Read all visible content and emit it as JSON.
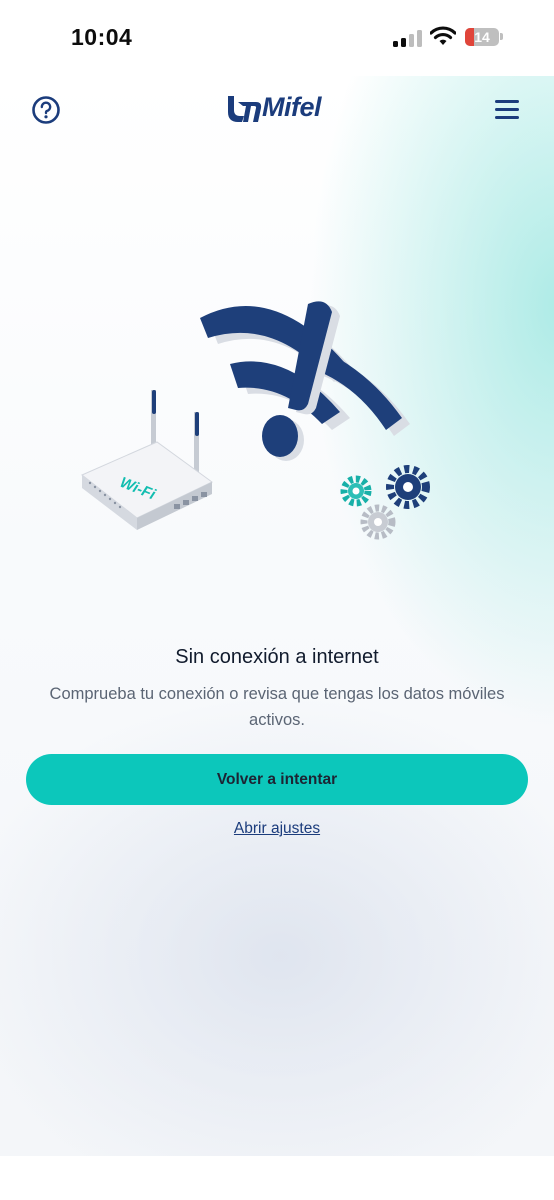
{
  "status_bar": {
    "time": "10:04",
    "battery_level": "14",
    "battery_color": "#e0453a",
    "signal_icon": "cellular-signal-icon",
    "wifi_icon": "wifi-icon"
  },
  "header": {
    "help_icon": "question-circle-icon",
    "logo_text": "Mifel",
    "menu_icon": "hamburger-menu-icon"
  },
  "illustration": {
    "router_label": "Wi-Fi"
  },
  "content": {
    "title": "Sin conexión a internet",
    "message": "Comprueba tu conexión o revisa que tengas los datos móviles activos.",
    "retry_label": "Volver a intentar",
    "settings_link": "Abrir ajustes"
  },
  "colors": {
    "brand_navy": "#1b3c7c",
    "accent_teal": "#0cc7bb"
  }
}
